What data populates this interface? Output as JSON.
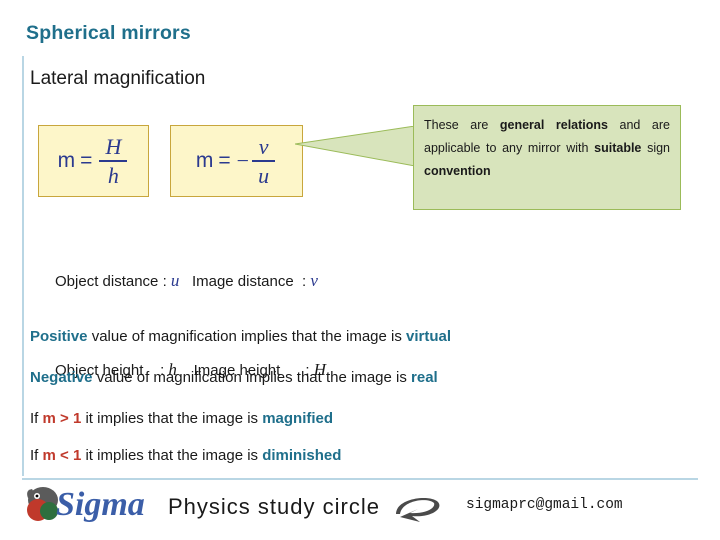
{
  "slide": {
    "title": "Spherical mirrors",
    "subtitle": "Lateral magnification"
  },
  "formulas": [
    {
      "id": "formula-m-H-over-h",
      "lhs": "m",
      "equals": "=",
      "sign": "",
      "numerator": "H",
      "denominator": "h"
    },
    {
      "id": "formula-m-minus-v-over-u",
      "lhs": "m",
      "equals": "=",
      "sign": "−",
      "numerator": "v",
      "denominator": "u"
    }
  ],
  "callout": {
    "line1_a": "These are ",
    "line1_b": "general relations",
    "line2": "and are applicable to any",
    "line3_a": "mirror with ",
    "line3_b": "suitable",
    "line3_c": " sign",
    "line4": "convention",
    "full_text": "These are general relations and are applicable to any mirror with suitable sign convention"
  },
  "definitions": [
    {
      "label": "Object distance",
      "colon": ":",
      "symbol": "u"
    },
    {
      "label": "Image distance",
      "colon": ":",
      "symbol": "v"
    },
    {
      "label": "Object height",
      "colon": ":",
      "symbol": "h"
    },
    {
      "label": "Image height",
      "colon": ":",
      "symbol": "H"
    }
  ],
  "statements": [
    {
      "lead": "Positive",
      "middle": " value of magnification implies that the image is ",
      "tail": "virtual"
    },
    {
      "lead": "Negative",
      "middle": " value of magnification implies that the image is ",
      "tail": "real"
    },
    {
      "lead": "If ",
      "cond": "m > 1",
      "middle": " it implies that the image is ",
      "tail": "magnified"
    },
    {
      "lead": "If ",
      "cond": "m < 1",
      "middle": " it implies that the image is ",
      "tail": "diminished"
    }
  ],
  "footer": {
    "brand_sigma": "Sigma",
    "brand_tagline": "Physics study circle",
    "email": "sigmaprc@gmail.com"
  },
  "colors": {
    "title": "#1f6f8b",
    "accent_rule": "#b9d6e4",
    "formula_bg": "#fdf6c9",
    "formula_border": "#c8a63c",
    "formula_text": "#2b3a8f",
    "callout_bg": "#d8e4bc",
    "callout_border": "#9bbb59",
    "highlight_blue": "#1f6f8b",
    "highlight_red": "#c0392b"
  }
}
